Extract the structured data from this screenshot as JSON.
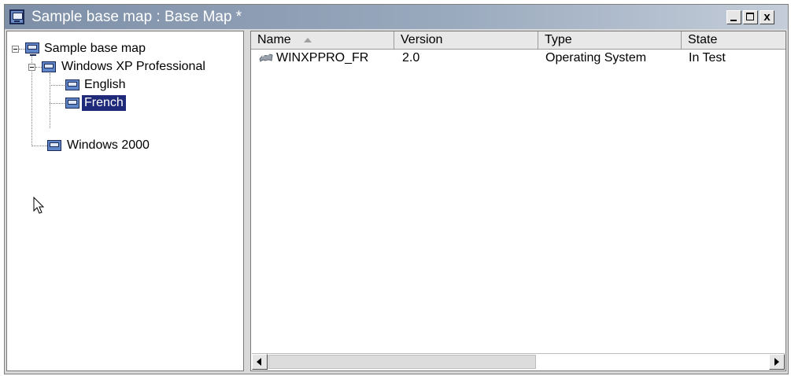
{
  "window": {
    "title": "Sample base map : Base Map *",
    "icon": "monitor-icon",
    "controls": {
      "minimize": "minimize-icon",
      "maximize": "maximize-icon",
      "close_label": "x"
    }
  },
  "tree": {
    "nodes": [
      {
        "label": "Sample base map",
        "expanded": true,
        "icon": "base-map-icon"
      },
      {
        "label": "Windows XP Professional",
        "expanded": true,
        "icon": "os-node-icon"
      },
      {
        "label": "English",
        "icon": "language-node-icon"
      },
      {
        "label": "French",
        "selected": true,
        "icon": "language-node-icon"
      },
      {
        "label": "Windows 2000",
        "icon": "os-node-icon"
      }
    ]
  },
  "list": {
    "columns": [
      {
        "label": "Name",
        "sorted": "ascending"
      },
      {
        "label": "Version"
      },
      {
        "label": "Type"
      },
      {
        "label": "State"
      }
    ],
    "rows": [
      {
        "name": "WINXPPRO_FR",
        "version": "2.0",
        "type": "Operating System",
        "state": "In Test",
        "icon": "operating-system-icon"
      }
    ]
  },
  "colors": {
    "selection": "#1f2b7a",
    "titlebar_start": "#7d8fa7",
    "titlebar_end": "#c4cdd9"
  }
}
